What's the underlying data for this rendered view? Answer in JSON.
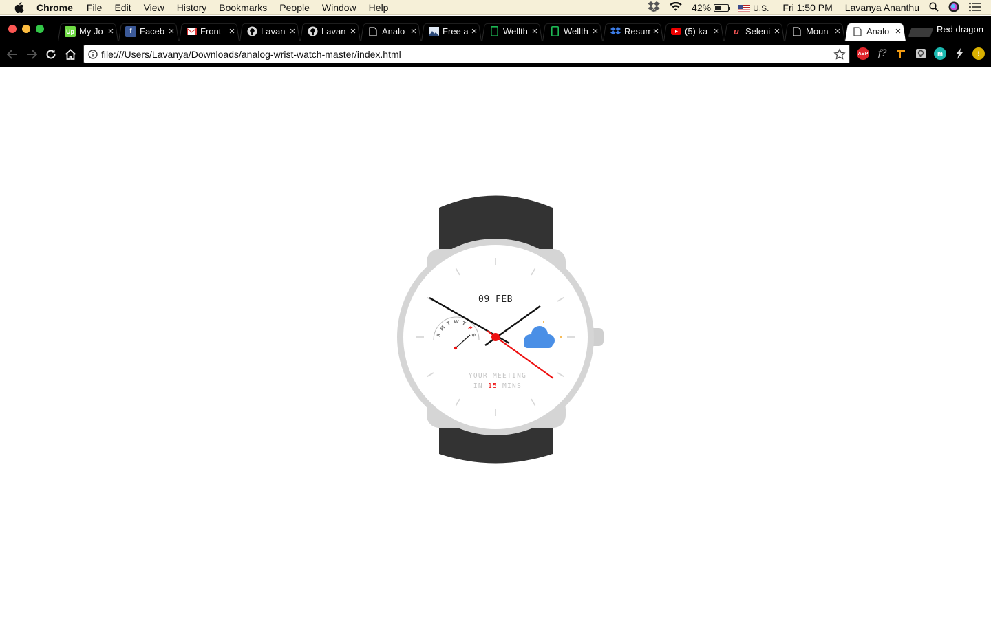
{
  "menubar": {
    "app_name": "Chrome",
    "items": [
      "File",
      "Edit",
      "View",
      "History",
      "Bookmarks",
      "People",
      "Window",
      "Help"
    ],
    "battery_percent": "42%",
    "input_source": "U.S.",
    "clock": "Fri 1:50 PM",
    "user": "Lavanya Ananthu",
    "battery_level": 0.42
  },
  "browser": {
    "profile_name": "Red dragon",
    "tabs": [
      {
        "title": "My Jo",
        "icon": "upwork-icon",
        "active": false
      },
      {
        "title": "Faceb",
        "icon": "facebook-icon",
        "active": false
      },
      {
        "title": "Front",
        "icon": "gmail-icon",
        "active": false
      },
      {
        "title": "Lavan",
        "icon": "github-icon",
        "active": false
      },
      {
        "title": "Lavan",
        "icon": "github-icon",
        "active": false
      },
      {
        "title": "Analo",
        "icon": "document-icon",
        "active": false
      },
      {
        "title": "Free a",
        "icon": "image-icon",
        "active": false
      },
      {
        "title": "Wellth",
        "icon": "sheet-icon",
        "active": false
      },
      {
        "title": "Wellth",
        "icon": "sheet-icon",
        "active": false
      },
      {
        "title": "Resum",
        "icon": "dropbox-icon",
        "active": false
      },
      {
        "title": "(5) ka",
        "icon": "youtube-icon",
        "active": false
      },
      {
        "title": "Seleni",
        "icon": "udemy-icon",
        "active": false
      },
      {
        "title": "Moun",
        "icon": "document-icon",
        "active": false
      },
      {
        "title": "Analo",
        "icon": "document-icon",
        "active": true
      }
    ],
    "address": "file:///Users/Lavanya/Downloads/analog-wrist-watch-master/index.html",
    "extensions": [
      "adblock-icon",
      "font-icon",
      "hammer-icon",
      "lightbulb-icon",
      "mint-icon",
      "bolt-icon",
      "warning-icon"
    ]
  },
  "watch": {
    "date": "09 FEB",
    "days": [
      "S",
      "M",
      "T",
      "W",
      "T",
      "F",
      "S"
    ],
    "current_day_index": 5,
    "message_line1": "YOUR MEETING",
    "message_prefix": "IN ",
    "message_number": "15",
    "message_suffix": " MINS",
    "weather_icon": "cloud-moon-icon",
    "colors": {
      "strap": "#333333",
      "bezel": "#d5d5d5",
      "accent": "#ee1111",
      "cloud": "#4a8fe6",
      "moon": "#f5a623"
    }
  }
}
